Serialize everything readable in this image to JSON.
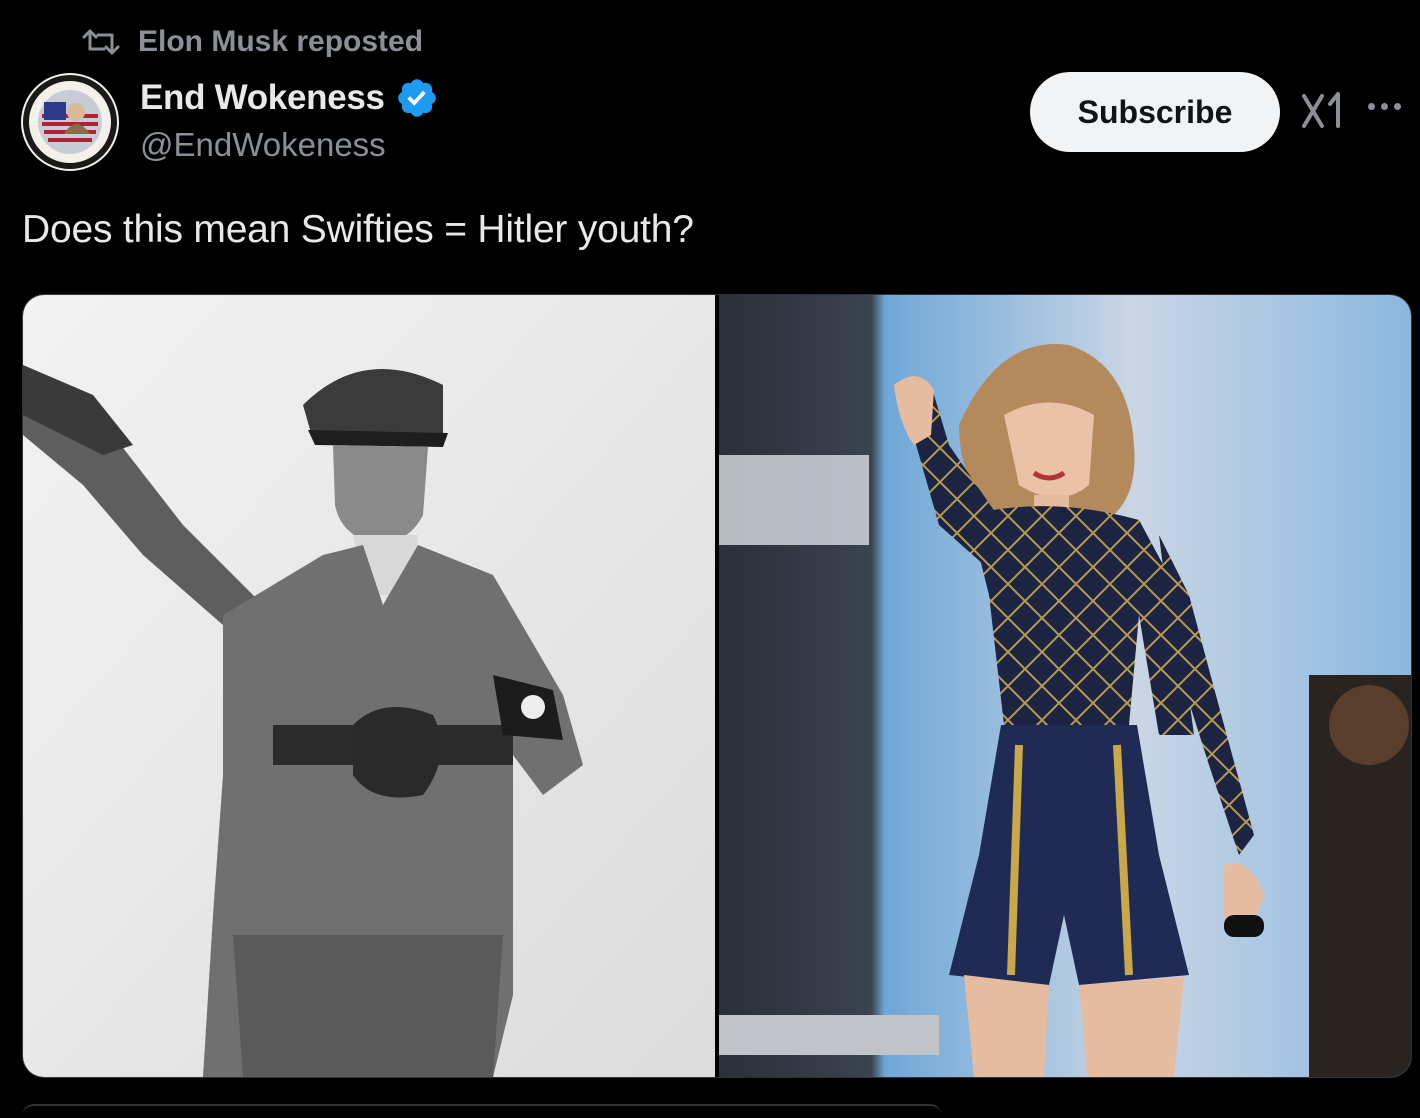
{
  "repost": {
    "icon": "repost-icon",
    "label": "Elon Musk reposted"
  },
  "author": {
    "name": "End Wokeness",
    "handle": "@EndWokeness",
    "verified": true,
    "verified_color": "#1d9bf0",
    "avatar_icon": "avatar-badge-icon"
  },
  "actions": {
    "subscribe_label": "Subscribe",
    "grok_icon": "grok-icon",
    "more_icon": "more-icon"
  },
  "post": {
    "text": "Does this mean Swifties = Hitler youth?"
  },
  "media": {
    "images": [
      {
        "name": "left-image",
        "style": "black-and-white"
      },
      {
        "name": "right-image",
        "style": "color"
      }
    ]
  },
  "colors": {
    "background": "#000000",
    "text_primary": "#e7e9ea",
    "text_secondary": "#8b9096",
    "button_bg": "#f2f3f4"
  }
}
